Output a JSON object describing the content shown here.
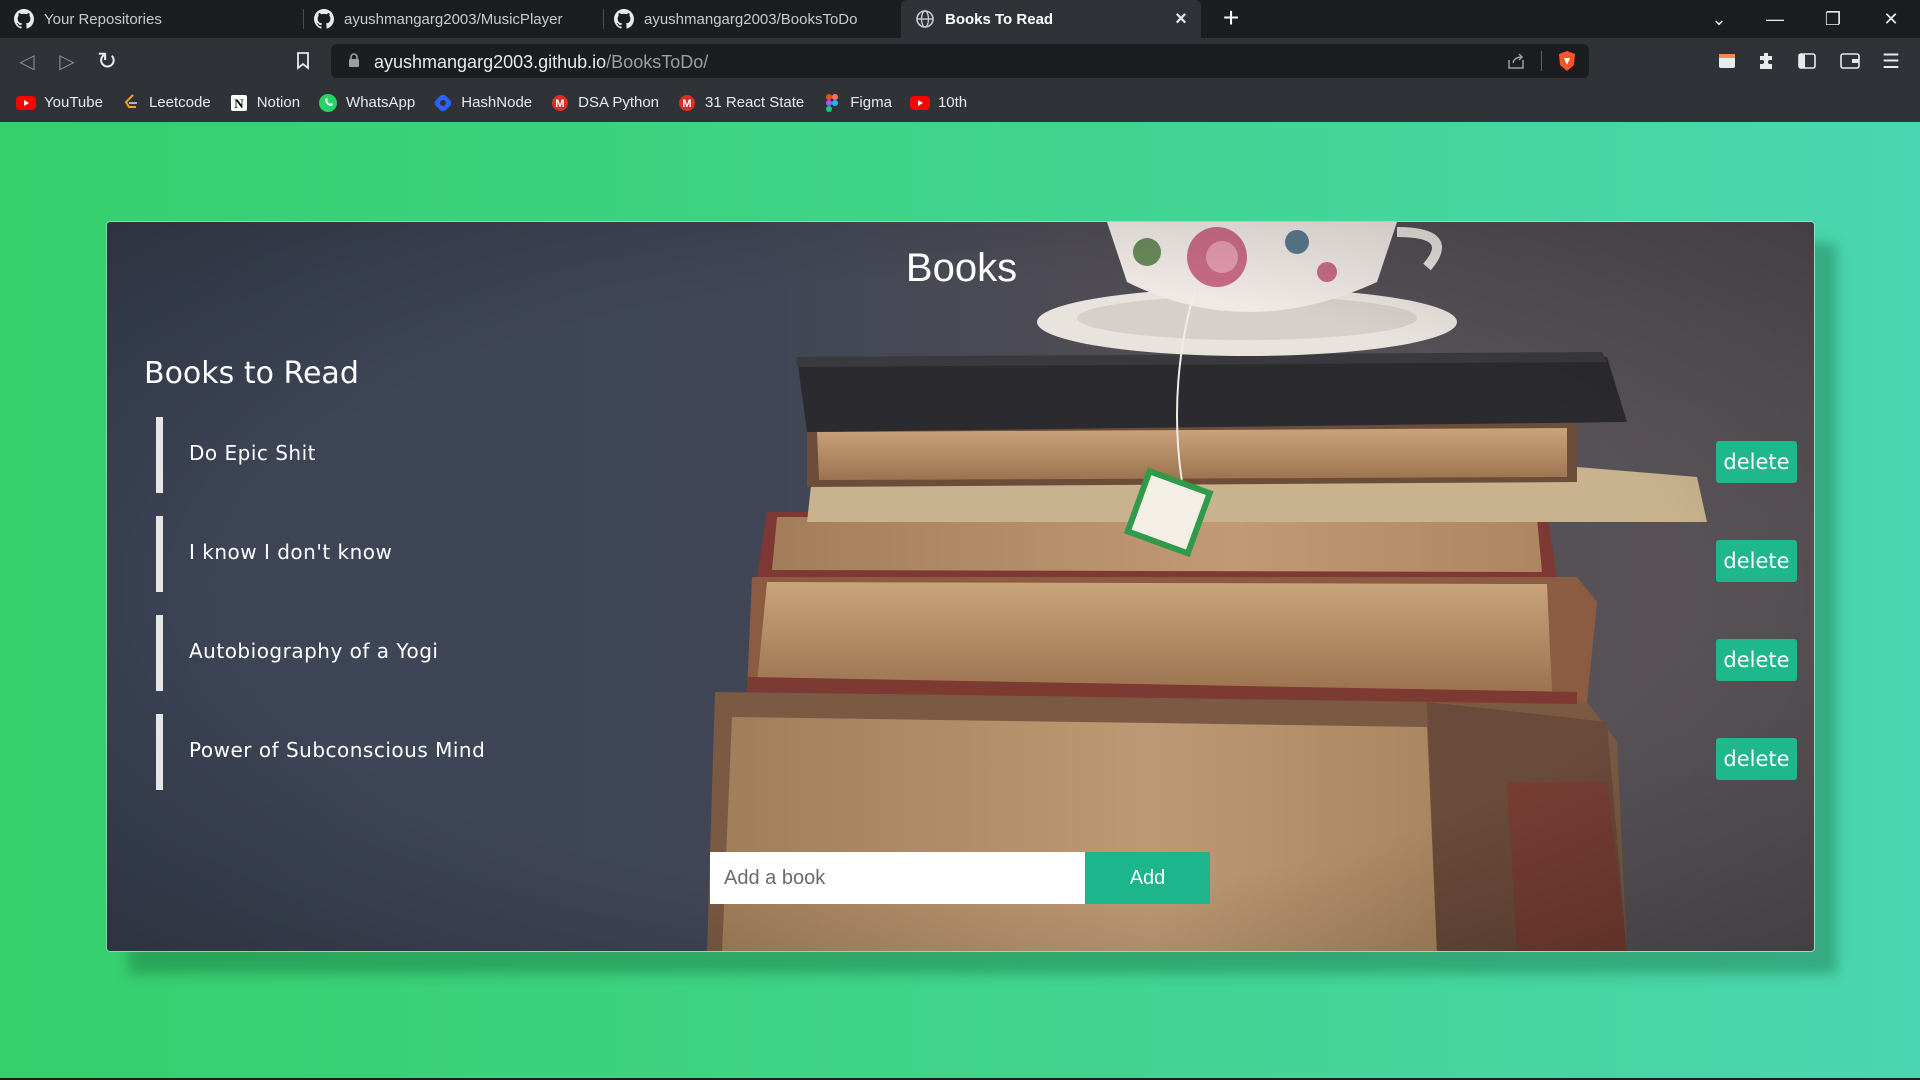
{
  "browser": {
    "tabs": [
      {
        "title": "Your Repositories",
        "icon": "github-icon",
        "active": false
      },
      {
        "title": "ayushmangarg2003/MusicPlayer",
        "icon": "github-icon",
        "active": false
      },
      {
        "title": "ayushmangarg2003/BooksToDo",
        "icon": "github-icon",
        "active": false
      },
      {
        "title": "Books To Read",
        "icon": "globe-icon",
        "active": true
      }
    ],
    "new_tab_label": "+",
    "url_host": "ayushmangarg2003.github.io",
    "url_path": "/BooksToDo/",
    "bookmarks": [
      {
        "label": "YouTube",
        "icon": "youtube-icon"
      },
      {
        "label": "Leetcode",
        "icon": "leetcode-icon"
      },
      {
        "label": "Notion",
        "icon": "notion-icon"
      },
      {
        "label": "WhatsApp",
        "icon": "whatsapp-icon"
      },
      {
        "label": "HashNode",
        "icon": "hashnode-icon"
      },
      {
        "label": "DSA Python",
        "icon": "gmail-icon"
      },
      {
        "label": "31 React State",
        "icon": "gmail-icon"
      },
      {
        "label": "Figma",
        "icon": "figma-icon"
      },
      {
        "label": "10th",
        "icon": "youtube-icon"
      }
    ]
  },
  "page": {
    "title": "Books",
    "subtitle": "Books to Read",
    "books": [
      {
        "title": "Do Epic Shit",
        "delete_label": "delete"
      },
      {
        "title": "I know I don't know",
        "delete_label": "delete"
      },
      {
        "title": "Autobiography of a Yogi",
        "delete_label": "delete"
      },
      {
        "title": "Power of Subconscious Mind",
        "delete_label": "delete"
      }
    ],
    "input_placeholder": "Add a book",
    "add_label": "Add"
  },
  "colors": {
    "accent": "#1fb88c",
    "page_gradient_start": "#35cf6c",
    "page_gradient_end": "#4ad6b0"
  }
}
